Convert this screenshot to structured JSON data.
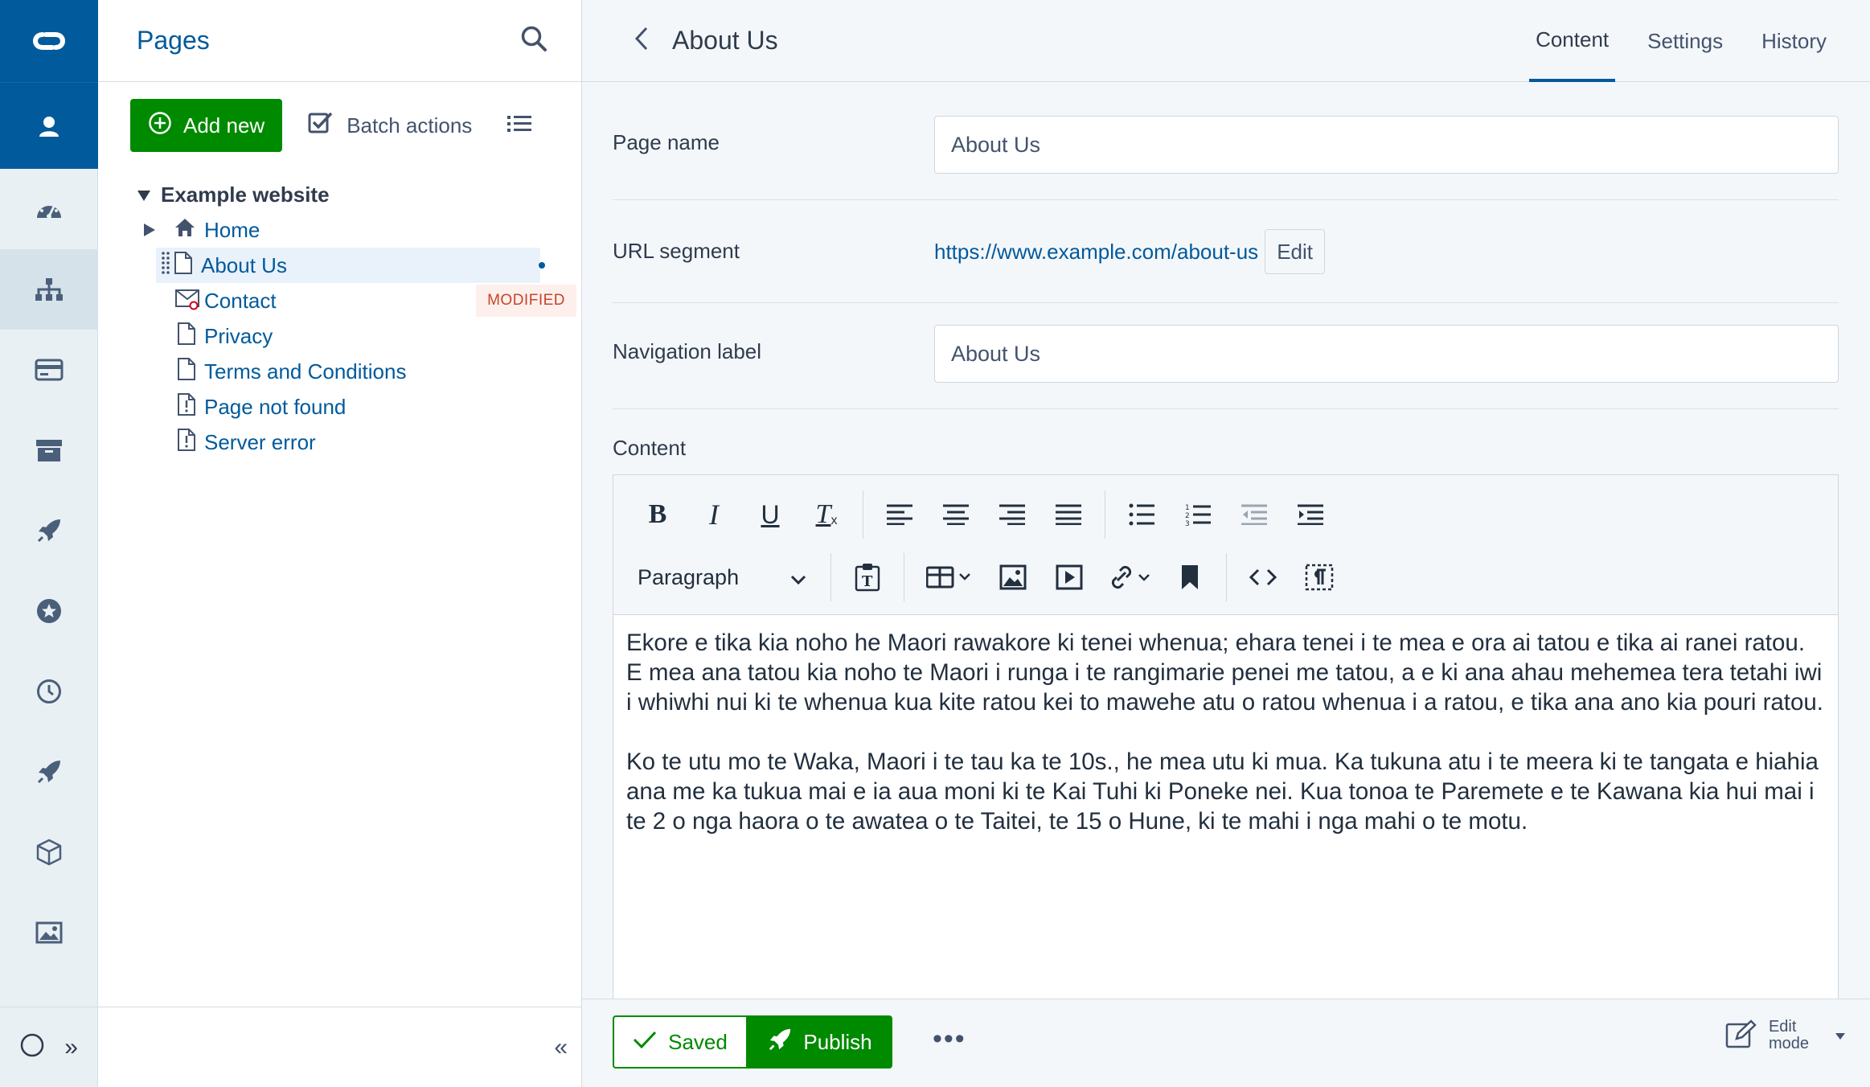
{
  "sidebar": {
    "items": [
      "dashboard-icon",
      "site-tree-icon",
      "card-icon",
      "archive-icon",
      "rocket-icon",
      "star-icon",
      "clock-icon",
      "rocket-icon",
      "cube-icon",
      "image-icon"
    ],
    "expand_label": "»"
  },
  "tree_panel": {
    "title": "Pages",
    "add_new_label": "Add new",
    "batch_actions_label": "Batch actions",
    "collapse_label": "«",
    "root": "Example website",
    "nodes": [
      {
        "label": "Home"
      },
      {
        "label": "About Us"
      },
      {
        "label": "Contact",
        "badge": "MODIFIED"
      },
      {
        "label": "Privacy"
      },
      {
        "label": "Terms and Conditions"
      },
      {
        "label": "Page not found"
      },
      {
        "label": "Server error"
      }
    ]
  },
  "main": {
    "title": "About Us",
    "tabs": [
      {
        "label": "Content",
        "active": true
      },
      {
        "label": "Settings"
      },
      {
        "label": "History"
      }
    ],
    "fields": {
      "page_name_label": "Page name",
      "page_name_value": "About Us",
      "url_segment_label": "URL segment",
      "url_value": "https://www.example.com/about-us",
      "url_edit_label": "Edit",
      "nav_label_label": "Navigation label",
      "nav_label_value": "About Us",
      "content_label": "Content"
    },
    "editor": {
      "block_format": "Paragraph",
      "paragraphs": [
        "Ekore e tika kia noho he Maori rawakore ki tenei whenua; ehara tenei i te mea e ora ai tatou e tika ai ranei ratou. E mea ana tatou kia noho te Maori i runga i te rangimarie penei me tatou, a e ki ana ahau mehemea tera tetahi iwi i whiwhi nui ki te whenua kua kite ratou kei to mawehe atu o ratou whenua i a ratou, e tika ana ano kia pouri ratou.",
        "Ko te utu mo te Waka, Maori i te tau ka te 10s., he mea utu ki mua. Ka tukuna atu i te meera ki te tangata e hiahia ana me ka tukua mai e ia aua moni ki te Kai Tuhi ki Poneke nei. Kua tonoa te Paremete e te Kawana kia hui mai i te 2 o nga haora o te awatea o te Taitei, te 15 o Hune, ki te mahi i nga mahi o te motu."
      ]
    },
    "actions": {
      "saved_label": "Saved",
      "publish_label": "Publish",
      "more_label": "•••",
      "edit_mode_line1": "Edit",
      "edit_mode_line2": "mode"
    }
  },
  "colors": {
    "brand": "#005a9c",
    "success": "#008a00",
    "modified": "#c8442b"
  }
}
